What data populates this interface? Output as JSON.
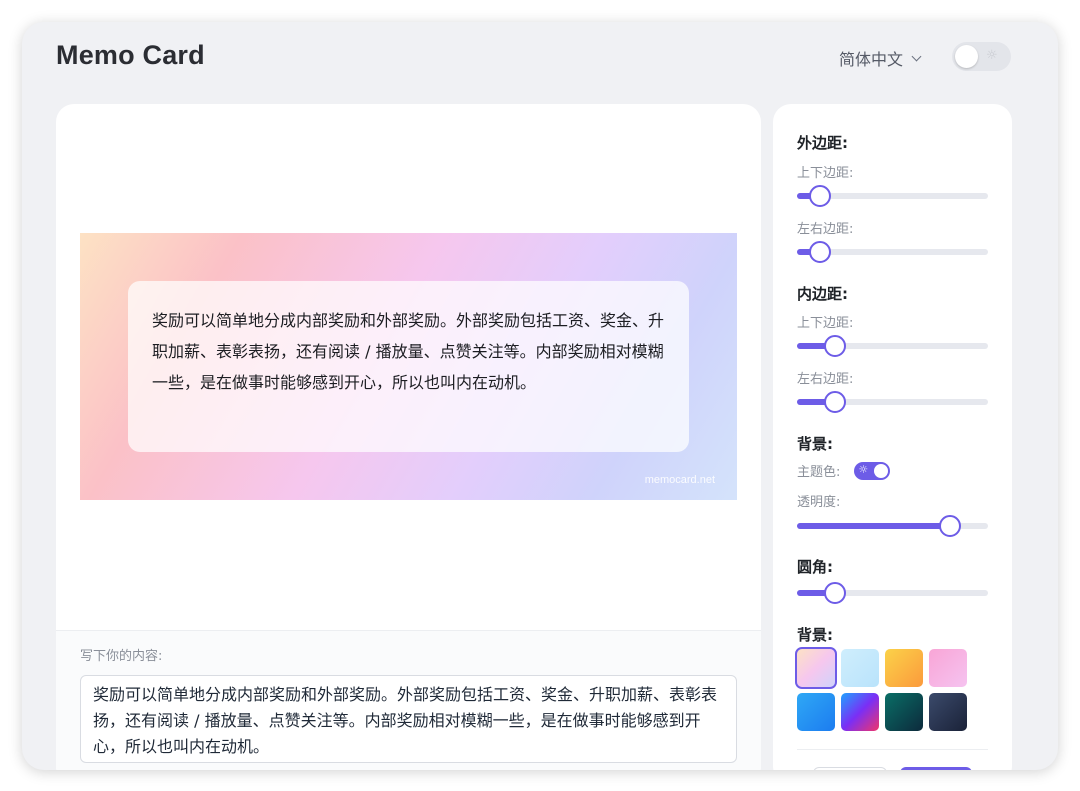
{
  "app": {
    "title": "Memo Card"
  },
  "header": {
    "language": "简体中文",
    "theme_icon": "sun-icon"
  },
  "card": {
    "text": "奖励可以简单地分成内部奖励和外部奖励。外部奖励包括工资、奖金、升职加薪、表彰表扬，还有阅读 / 播放量、点赞关注等。内部奖励相对模糊一些，是在做事时能够感到开心，所以也叫内在动机。",
    "watermark": "memocard.net"
  },
  "editor": {
    "label": "写下你的内容:",
    "content": "奖励可以简单地分成内部奖励和外部奖励。外部奖励包括工资、奖金、升职加薪、表彰表扬，还有阅读 / 播放量、点赞关注等。内部奖励相对模糊一些，是在做事时能够感到开心，所以也叫内在动机。"
  },
  "settings": {
    "margin": {
      "title": "外边距:",
      "vertical_label": "上下边距:",
      "vertical_value": 0.12,
      "horizontal_label": "左右边距:",
      "horizontal_value": 0.12
    },
    "padding": {
      "title": "内边距:",
      "vertical_label": "上下边距:",
      "vertical_value": 0.2,
      "horizontal_label": "左右边距:",
      "horizontal_value": 0.2
    },
    "background": {
      "title": "背景:",
      "theme_color_label": "主题色:",
      "theme_color_on": true,
      "opacity_label": "透明度:",
      "opacity_value": 0.8
    },
    "radius": {
      "title": "圆角:",
      "value": 0.2
    },
    "background_presets": {
      "title": "背景:",
      "selected_index": 0,
      "swatches": [
        "linear-gradient(135deg,#fde2c4,#f6c7ee,#cfd3fb)",
        "linear-gradient(135deg,#cfeefd,#b9e3fb)",
        "linear-gradient(135deg,#fbd249,#fb9a3c)",
        "linear-gradient(135deg,#f8a5d6,#f6c3f0)",
        "linear-gradient(135deg,#2fa8f5,#1c7cf0)",
        "linear-gradient(135deg,#1fa2ff,#7a2ff5,#f0356a)",
        "linear-gradient(135deg,#0a6e66,#0c2a3c)",
        "linear-gradient(135deg,#3b4a6b,#1a2238)"
      ]
    }
  },
  "colors": {
    "accent": "#6d5ce7",
    "panel": "#ffffff",
    "window": "#f0f1f4"
  }
}
